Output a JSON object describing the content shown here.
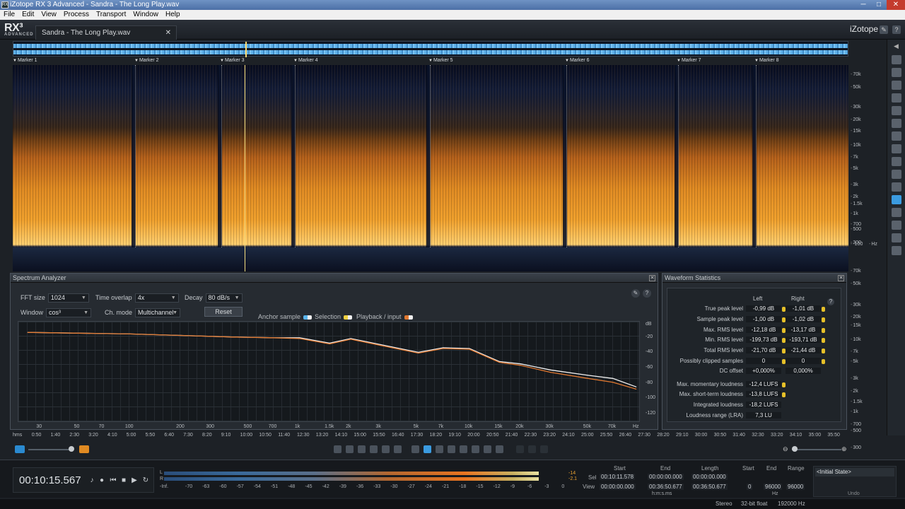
{
  "window": {
    "title": "iZotope RX 3 Advanced - Sandra - The Long Play.wav",
    "minimize": "─",
    "maximize": "□",
    "close": "✕"
  },
  "menu": [
    "File",
    "Edit",
    "View",
    "Process",
    "Transport",
    "Window",
    "Help"
  ],
  "app": {
    "logo": "RX³",
    "logo_sub": "ADVANCED",
    "brand": "iZotope",
    "file_tab": "Sandra - The Long Play.wav",
    "tab_close": "✕"
  },
  "markers": [
    "Marker 1",
    "Marker 2",
    "Marker 3",
    "Marker 4",
    "Marker 5",
    "Marker 6",
    "Marker 7",
    "Marker 8"
  ],
  "hz_scale": [
    "70k",
    "50k",
    "30k",
    "20k",
    "15k",
    "10k",
    "7k",
    "5k",
    "3k",
    "2k",
    "1.5k",
    "1k",
    "700",
    "500",
    "300",
    "-100",
    "Hz",
    "70k",
    "50k",
    "30k",
    "20k",
    "15k",
    "10k",
    "7k",
    "5k",
    "3k",
    "2k",
    "1.5k",
    "1k",
    "700",
    "500",
    "300",
    "100"
  ],
  "spectrum_analyzer": {
    "title": "Spectrum Analyzer",
    "fft_label": "FFT size",
    "fft_value": "1024",
    "overlap_label": "Time overlap",
    "overlap_value": "4x",
    "decay_label": "Decay",
    "decay_value": "80 dB/s",
    "window_label": "Window",
    "window_value": "cos³",
    "chmode_label": "Ch. mode",
    "chmode_value": "Multichannel",
    "reset_label": "Reset",
    "legend_anchor": "Anchor sample",
    "legend_selection": "Selection",
    "legend_playback": "Playback / input",
    "y_ticks": [
      "dB",
      "-20",
      "-40",
      "-60",
      "-80",
      "-100",
      "-120"
    ],
    "x_ticks": [
      "30",
      "50",
      "70",
      "100",
      "200",
      "300",
      "500",
      "700",
      "1k",
      "1.5k",
      "2k",
      "3k",
      "5k",
      "7k",
      "10k",
      "15k",
      "20k",
      "30k",
      "50k",
      "70k",
      "Hz"
    ]
  },
  "chart_data": {
    "type": "line",
    "xlabel": "Hz",
    "ylabel": "dB",
    "ylim": [
      -130,
      0
    ],
    "x": [
      25,
      50,
      100,
      200,
      400,
      700,
      1000,
      1500,
      2000,
      3000,
      5000,
      7000,
      10000,
      15000,
      20000,
      30000,
      50000,
      70000,
      96000
    ],
    "series": [
      {
        "color": "#f0f0f0",
        "values": [
          -14,
          -15,
          -16,
          -18,
          -20,
          -21,
          -21,
          -28,
          -22,
          -30,
          -40,
          -34,
          -35,
          -52,
          -55,
          -63,
          -70,
          -74,
          -85
        ]
      },
      {
        "color": "#e07830",
        "values": [
          -14,
          -15,
          -16,
          -18,
          -20,
          -21,
          -22,
          -29,
          -23,
          -31,
          -41,
          -35,
          -36,
          -53,
          -57,
          -66,
          -74,
          -79,
          -88
        ]
      }
    ]
  },
  "waveform_statistics": {
    "title": "Waveform Statistics",
    "col_left": "Left",
    "col_right": "Right",
    "help": "?",
    "rows": [
      {
        "label": "True peak level",
        "left": "-0,99 dB",
        "right": "-1,01 dB"
      },
      {
        "label": "Sample peak level",
        "left": "-1,00 dB",
        "right": "-1,02 dB"
      },
      {
        "label": "Max. RMS level",
        "left": "-12,18 dB",
        "right": "-13,17 dB"
      },
      {
        "label": "Min. RMS level",
        "left": "-199,73 dB",
        "right": "-193,71 dB"
      },
      {
        "label": "Total RMS level",
        "left": "-21,70 dB",
        "right": "-21,44 dB"
      },
      {
        "label": "Possibly clipped samples",
        "left": "0",
        "right": "0"
      },
      {
        "label": "DC offset",
        "left": "+0,000%",
        "right": "0,000%"
      }
    ],
    "loudness": [
      {
        "label": "Max. momentary loudness",
        "value": "-12,4 LUFS"
      },
      {
        "label": "Max. short-term loudness",
        "value": "-13,8 LUFS"
      },
      {
        "label": "Integrated loudness",
        "value": "-18,2 LUFS"
      },
      {
        "label": "Loudness range (LRA)",
        "value": "7,3 LU"
      }
    ]
  },
  "timeline": [
    "hms",
    "0:50",
    "1:40",
    "2:30",
    "3:20",
    "4:10",
    "5:00",
    "5:50",
    "6:40",
    "7:30",
    "8:20",
    "9:10",
    "10:00",
    "10:50",
    "11:40",
    "12:30",
    "13:20",
    "14:10",
    "15:00",
    "15:50",
    "16:40",
    "17:30",
    "18:20",
    "19:10",
    "20:00",
    "20:50",
    "21:40",
    "22:30",
    "23:20",
    "24:10",
    "25:00",
    "25:50",
    "26:40",
    "27:30",
    "28:20",
    "29:10",
    "30:00",
    "30:50",
    "31:40",
    "32:30",
    "33:20",
    "34:10",
    "35:00",
    "35:50"
  ],
  "transport": {
    "time": "00:10:15.567",
    "meter_L": "L",
    "meter_R": "R",
    "peak_L": "-14",
    "peak_R": "-2.1",
    "meter_scale": [
      "-Inf.",
      "-70",
      "-63",
      "-60",
      "-57",
      "-54",
      "-51",
      "-48",
      "-45",
      "-42",
      "-39",
      "-36",
      "-33",
      "-30",
      "-27",
      "-24",
      "-21",
      "-18",
      "-15",
      "-12",
      "-9",
      "-6",
      "-3",
      "0"
    ]
  },
  "selection": {
    "h_start": "Start",
    "h_end": "End",
    "h_length": "Length",
    "h_start2": "Start",
    "h_end2": "End",
    "h_range": "Range",
    "sel_label": "Sel",
    "view_label": "View",
    "sel_start": "00:10:11.578",
    "sel_end": "00:00:00.000",
    "sel_length": "00:00:00.000",
    "view_start": "00:00:00.000",
    "view_end": "00:36:50.677",
    "view_length": "00:36:50.677",
    "freq_start": "0",
    "freq_end": "96000",
    "freq_range": "96000",
    "unit_time": "h:m:s.ms",
    "unit_freq": "Hz"
  },
  "undo": {
    "item": "<Initial State>",
    "label": "Undo"
  },
  "status": {
    "channels": "Stereo",
    "format": "32-bit float",
    "rate": "192000 Hz"
  }
}
